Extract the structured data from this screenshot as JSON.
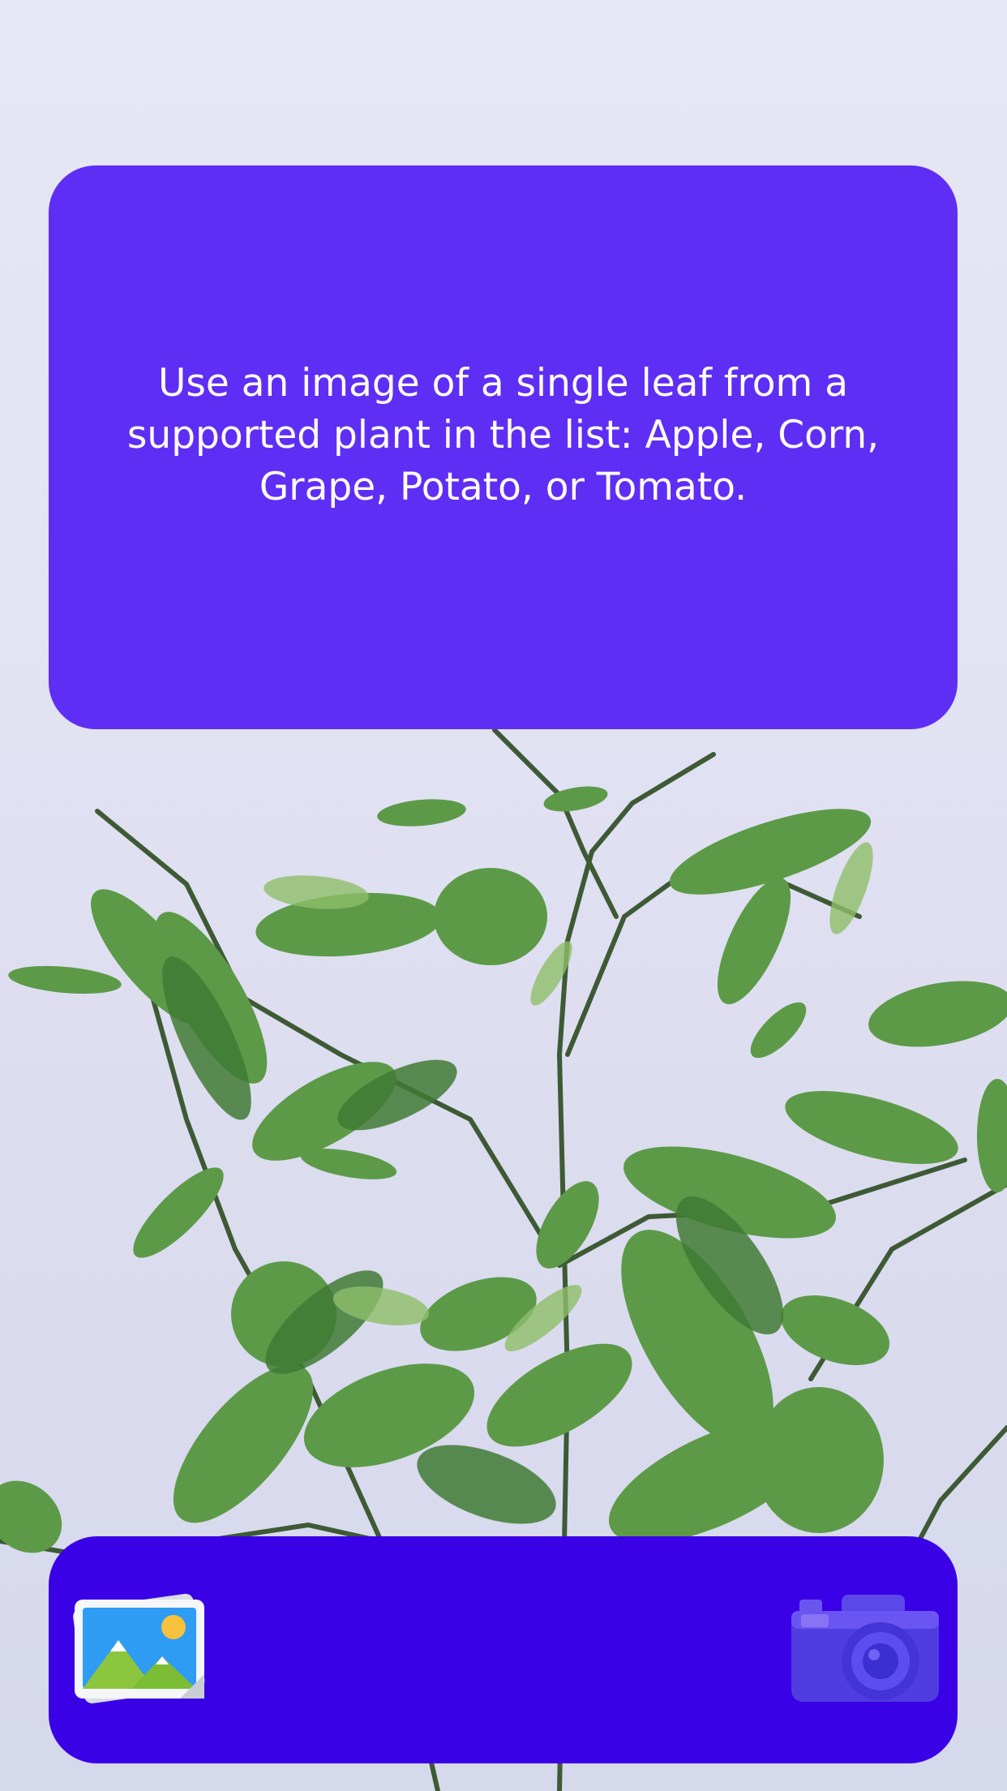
{
  "instruction": {
    "text": "Use an image of a single leaf from a supported plant in the list: Apple, Corn, Grape, Potato, or Tomato."
  },
  "actions": {
    "gallery_icon": "photo-gallery-icon",
    "camera_icon": "camera-icon"
  },
  "colors": {
    "info_card": "#5f2ef4",
    "action_bar": "#3a00e6",
    "leaf_green": "#4f8a3c"
  }
}
